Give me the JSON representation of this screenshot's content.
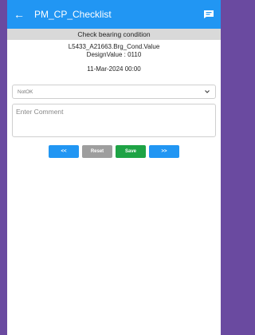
{
  "app": {
    "title": "PM_CP_Checklist"
  },
  "task": {
    "header": "Check bearing condition"
  },
  "info": {
    "tag": "L5433_A21663.Brg_Cond.Value",
    "design": "DesignValue : 0110",
    "date": "11-Mar-2024 00:00"
  },
  "status_select": {
    "value": "NotOK"
  },
  "comment": {
    "placeholder": "Enter Comment"
  },
  "buttons": {
    "prev": "<<",
    "reset": "Reset",
    "save": "Save",
    "next": ">>"
  },
  "colors": {
    "primary": "#2196f3",
    "save": "#1ea345",
    "reset": "#9e9e9e",
    "background": "#6a4aa0"
  }
}
